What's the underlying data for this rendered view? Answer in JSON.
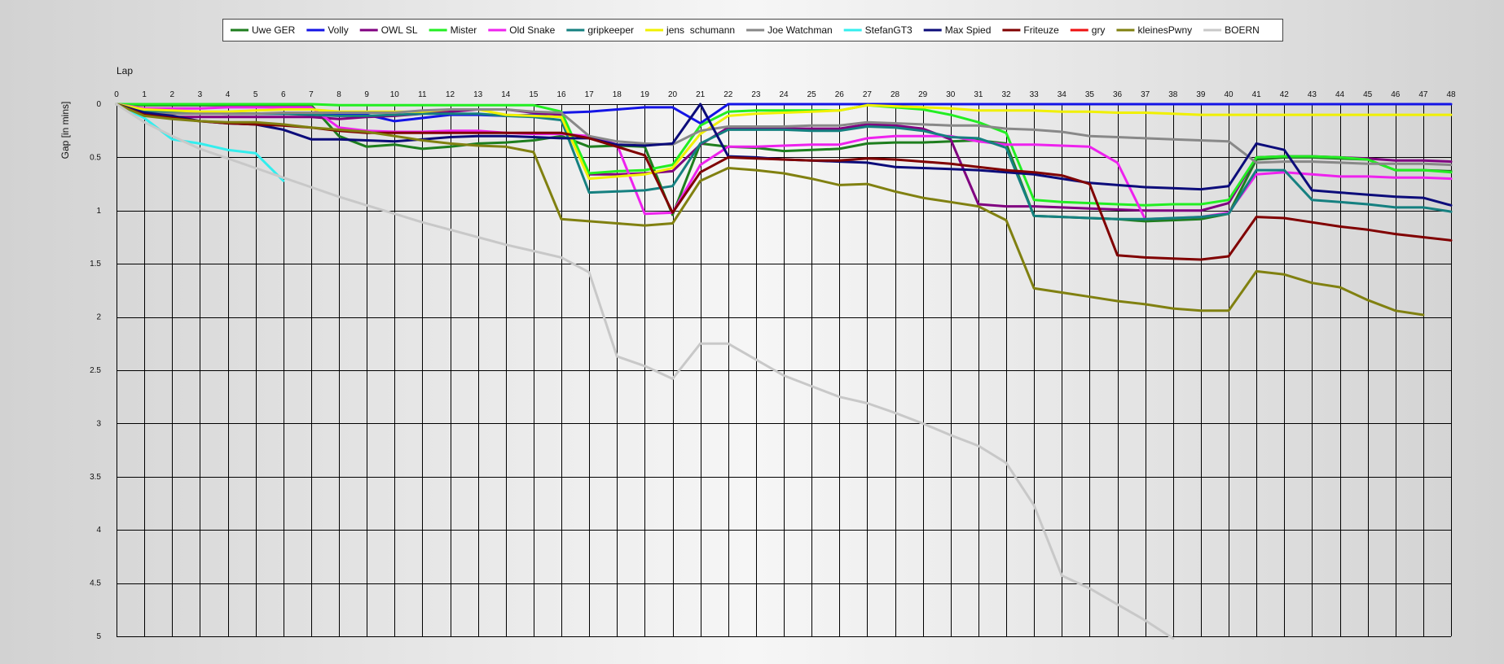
{
  "chart_data": {
    "type": "line",
    "xlabel": "Lap",
    "ylabel": "Gap [in mins]",
    "xlim": [
      0,
      48
    ],
    "ylim": [
      0,
      5
    ],
    "y_inverted": true,
    "xticks": [
      0,
      1,
      2,
      3,
      4,
      5,
      6,
      7,
      8,
      9,
      10,
      11,
      12,
      13,
      14,
      15,
      16,
      17,
      18,
      19,
      20,
      21,
      22,
      23,
      24,
      25,
      26,
      27,
      28,
      29,
      30,
      31,
      32,
      33,
      34,
      35,
      36,
      37,
      38,
      39,
      40,
      41,
      42,
      43,
      44,
      45,
      46,
      47,
      48
    ],
    "yticks": [
      "0",
      "0.5",
      "1",
      "1.5",
      "2",
      "2.5",
      "3",
      "3.5",
      "4",
      "4.5",
      "5"
    ],
    "grid": true,
    "legend_position": "top-center",
    "series": [
      {
        "name": "Uwe GER",
        "color": "#1e7e1e",
        "values": [
          0,
          0.01,
          0.01,
          0.01,
          0.01,
          0.01,
          0.01,
          0.01,
          0.3,
          0.4,
          0.38,
          0.42,
          0.4,
          0.37,
          0.36,
          0.34,
          0.3,
          0.4,
          0.39,
          0.4,
          1.04,
          0.37,
          0.4,
          0.41,
          0.44,
          0.43,
          0.42,
          0.37,
          0.36,
          0.36,
          0.35,
          0.34,
          0.37,
          1.05,
          1.06,
          1.07,
          1.08,
          1.1,
          1.09,
          1.08,
          1.03,
          0.52,
          0.5,
          0.5,
          0.51,
          0.52,
          0.62,
          0.62,
          0.63
        ]
      },
      {
        "name": "Volly",
        "color": "#1414e6",
        "values": [
          0,
          0.06,
          0.07,
          0.08,
          0.09,
          0.09,
          0.09,
          0.09,
          0.1,
          0.1,
          0.16,
          0.13,
          0.1,
          0.1,
          0.11,
          0.1,
          0.08,
          0.07,
          0.05,
          0.03,
          0.03,
          0.18,
          0,
          0,
          0,
          0,
          0,
          0,
          0,
          0,
          0,
          0,
          0,
          0,
          0,
          0,
          0,
          0,
          0,
          0,
          0,
          0,
          0,
          0,
          0,
          0,
          0,
          0,
          0
        ]
      },
      {
        "name": "OWL SL",
        "color": "#800080",
        "values": [
          0,
          0.1,
          0.12,
          0.12,
          0.12,
          0.12,
          0.12,
          0.12,
          0.14,
          0.12,
          0.11,
          0.09,
          0.07,
          0.05,
          0.05,
          0.08,
          0.1,
          0.66,
          0.66,
          0.65,
          0.63,
          0.38,
          0.22,
          0.22,
          0.23,
          0.23,
          0.23,
          0.19,
          0.2,
          0.23,
          0.33,
          0.94,
          0.96,
          0.96,
          0.97,
          0.98,
          0.99,
          1.0,
          1.0,
          1.0,
          0.93,
          0.5,
          0.49,
          0.49,
          0.5,
          0.51,
          0.53,
          0.53,
          0.54
        ]
      },
      {
        "name": "Mister",
        "color": "#22ee22",
        "values": [
          0,
          0,
          0,
          0,
          0,
          0,
          0,
          0,
          0.01,
          0.01,
          0.01,
          0.01,
          0.01,
          0.01,
          0.01,
          0.01,
          0.07,
          0.65,
          0.63,
          0.62,
          0.57,
          0.2,
          0.07,
          0.06,
          0.06,
          0.06,
          0.06,
          0.01,
          0.03,
          0.05,
          0.1,
          0.17,
          0.27,
          0.9,
          0.92,
          0.93,
          0.94,
          0.95,
          0.94,
          0.94,
          0.9,
          0.5,
          0.49,
          0.49,
          0.5,
          0.52,
          0.62,
          0.62,
          0.64
        ]
      },
      {
        "name": "Old Snake",
        "color": "#ee22ee",
        "values": [
          0,
          0.04,
          0.04,
          0.04,
          0.03,
          0.03,
          0.03,
          0.03,
          0.22,
          0.25,
          0.26,
          0.26,
          0.25,
          0.25,
          0.27,
          0.28,
          0.28,
          0.3,
          0.38,
          1.03,
          1.02,
          0.57,
          0.4,
          0.4,
          0.39,
          0.38,
          0.38,
          0.32,
          0.3,
          0.3,
          0.3,
          0.35,
          0.38,
          0.38,
          0.39,
          0.4,
          0.55,
          1.08,
          1.07,
          1.06,
          1.02,
          0.66,
          0.64,
          0.66,
          0.68,
          0.68,
          0.69,
          0.69,
          0.7
        ]
      },
      {
        "name": "gripkeeper",
        "color": "#158080",
        "values": [
          0,
          0.07,
          0.08,
          0.08,
          0.09,
          0.09,
          0.09,
          0.1,
          0.11,
          0.11,
          0.1,
          0.09,
          0.09,
          0.09,
          0.11,
          0.12,
          0.15,
          0.83,
          0.82,
          0.81,
          0.77,
          0.37,
          0.24,
          0.24,
          0.24,
          0.25,
          0.25,
          0.21,
          0.22,
          0.25,
          0.31,
          0.32,
          0.41,
          1.05,
          1.06,
          1.07,
          1.08,
          1.08,
          1.07,
          1.06,
          1.03,
          0.62,
          0.62,
          0.9,
          0.92,
          0.94,
          0.97,
          0.97,
          1.01
        ]
      },
      {
        "name": "jens  schumann",
        "color": "#f0f000",
        "values": [
          0,
          0.05,
          0.06,
          0.07,
          0.07,
          0.06,
          0.05,
          0.05,
          0.07,
          0.07,
          0.07,
          0.07,
          0.05,
          0.05,
          0.1,
          0.11,
          0.12,
          0.7,
          0.68,
          0.66,
          0.6,
          0.28,
          0.11,
          0.09,
          0.08,
          0.07,
          0.06,
          0.01,
          0.02,
          0.03,
          0.04,
          0.06,
          0.06,
          0.06,
          0.07,
          0.07,
          0.08,
          0.08,
          0.09,
          0.1,
          0.1,
          0.1,
          0.1,
          0.1,
          0.1,
          0.1,
          0.1,
          0.1,
          0.1
        ]
      },
      {
        "name": "Joe Watchman",
        "color": "#888888",
        "values": [
          0,
          0.09,
          0.09,
          0.09,
          0.09,
          0.09,
          0.08,
          0.08,
          0.08,
          0.08,
          0.08,
          0.06,
          0.05,
          0.05,
          0.05,
          0.07,
          0.08,
          0.3,
          0.35,
          0.37,
          0.38,
          0.25,
          0.21,
          0.21,
          0.21,
          0.2,
          0.2,
          0.17,
          0.18,
          0.19,
          0.2,
          0.2,
          0.23,
          0.24,
          0.26,
          0.3,
          0.31,
          0.32,
          0.33,
          0.34,
          0.35,
          0.55,
          0.54,
          0.54,
          0.55,
          0.56,
          0.56,
          0.56,
          0.57
        ]
      },
      {
        "name": "StefanGT3",
        "color": "#33eeee",
        "values": [
          0,
          0.13,
          0.33,
          0.37,
          0.43,
          0.46,
          0.72
        ]
      },
      {
        "name": "Max Spied",
        "color": "#0c0c7a",
        "values": [
          0,
          0.08,
          0.11,
          0.16,
          0.18,
          0.19,
          0.24,
          0.33,
          0.33,
          0.34,
          0.35,
          0.33,
          0.31,
          0.3,
          0.3,
          0.31,
          0.32,
          0.32,
          0.38,
          0.39,
          0.37,
          0,
          0.49,
          0.5,
          0.52,
          0.53,
          0.54,
          0.55,
          0.59,
          0.6,
          0.61,
          0.62,
          0.64,
          0.66,
          0.7,
          0.74,
          0.76,
          0.78,
          0.79,
          0.8,
          0.77,
          0.37,
          0.43,
          0.81,
          0.83,
          0.85,
          0.87,
          0.88,
          0.95
        ]
      },
      {
        "name": "Friteuze",
        "color": "#800000",
        "values": [
          0,
          0.1,
          0.13,
          0.16,
          0.18,
          0.19,
          0.2,
          0.22,
          0.25,
          0.27,
          0.27,
          0.27,
          0.27,
          0.27,
          0.27,
          0.27,
          0.27,
          0.32,
          0.4,
          0.48,
          1.02,
          0.64,
          0.5,
          0.51,
          0.52,
          0.53,
          0.53,
          0.51,
          0.52,
          0.54,
          0.56,
          0.59,
          0.62,
          0.64,
          0.67,
          0.75,
          1.42,
          1.44,
          1.45,
          1.46,
          1.43,
          1.06,
          1.07,
          1.11,
          1.15,
          1.18,
          1.22,
          1.25,
          1.28
        ]
      },
      {
        "name": "gry",
        "color": "#ee1111",
        "values": []
      },
      {
        "name": "kleinesPwny",
        "color": "#808010",
        "values": [
          0,
          0.11,
          0.14,
          0.16,
          0.17,
          0.17,
          0.19,
          0.22,
          0.24,
          0.26,
          0.3,
          0.34,
          0.37,
          0.39,
          0.4,
          0.45,
          1.08,
          1.1,
          1.12,
          1.14,
          1.12,
          0.72,
          0.6,
          0.62,
          0.65,
          0.7,
          0.76,
          0.75,
          0.82,
          0.88,
          0.92,
          0.96,
          1.09,
          1.73,
          1.77,
          1.81,
          1.85,
          1.88,
          1.92,
          1.94,
          1.94,
          1.57,
          1.6,
          1.68,
          1.72,
          1.84,
          1.94,
          1.98
        ]
      },
      {
        "name": "BOERN",
        "color": "#c8c8c8",
        "values": [
          0,
          0.17,
          0.3,
          0.42,
          0.51,
          0.6,
          0.69,
          0.78,
          0.87,
          0.95,
          1.03,
          1.11,
          1.18,
          1.25,
          1.32,
          1.38,
          1.44,
          1.58,
          2.37,
          2.46,
          2.58,
          2.25,
          2.25,
          2.4,
          2.55,
          2.65,
          2.75,
          2.81,
          2.9,
          3.0,
          3.11,
          3.21,
          3.37,
          3.77,
          4.43,
          4.55,
          4.7,
          4.85,
          5.02
        ]
      }
    ]
  }
}
